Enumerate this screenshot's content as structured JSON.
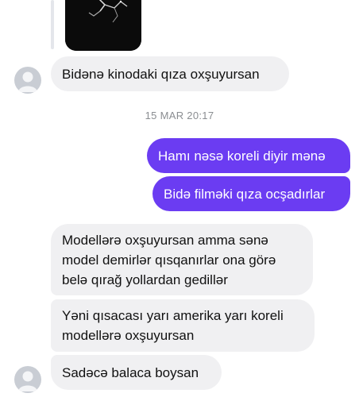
{
  "messages": {
    "m1": "Bidənə kinodaki qıza oxşuyursan",
    "timestamp": "15 MAR 20:17",
    "m2": "Hamı nəsə koreli diyir mənə",
    "m3": "Bidə filməki qıza ocşadırlar",
    "m4": "Modellərə oxşuyursan amma sənə\nmodel demirlər qısqanırlar ona görə\nbelə qırağ yollardan gedillər",
    "m5": "Yəni qısacası yarı amerika yarı koreli\nmodellərə oxşuyursan",
    "m6": "Sadəcə balaca boysan"
  },
  "colors": {
    "incoming_bubble": "#f0f0f2",
    "outgoing_bubble": "#6b3cf2",
    "timestamp": "#8a8d91"
  }
}
